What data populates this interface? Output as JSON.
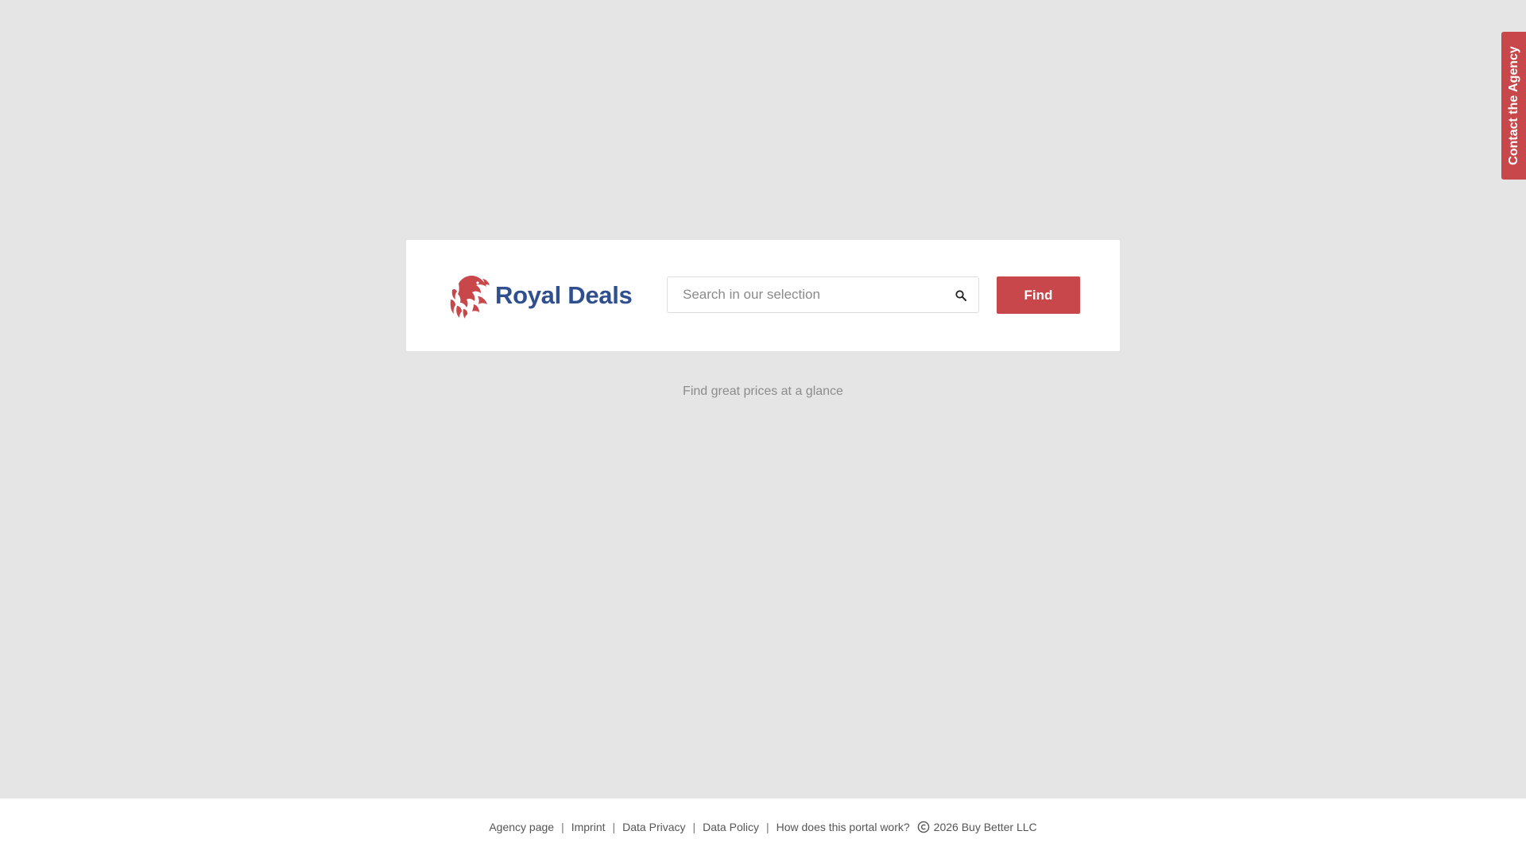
{
  "brand": {
    "name": "Royal Deals",
    "colors": {
      "brand_blue": "#2f4f8f",
      "accent_red": "#c8474a",
      "background": "#e5e5e5"
    },
    "logo_icon": "lion-head-icon"
  },
  "search": {
    "placeholder": "Search in our selection",
    "value": "",
    "icon": "search-icon",
    "button_label": "Find"
  },
  "tagline": "Find great prices at a glance",
  "contact_tab": {
    "label": "Contact the Agency"
  },
  "footer": {
    "links": [
      {
        "label": "Agency page"
      },
      {
        "label": "Imprint"
      },
      {
        "label": "Data Privacy"
      },
      {
        "label": "Data Policy"
      },
      {
        "label": "How does this portal work?"
      }
    ],
    "separator": "|",
    "copyright_icon": "copyright-icon",
    "copyright_text": "2026 Buy Better LLC"
  }
}
